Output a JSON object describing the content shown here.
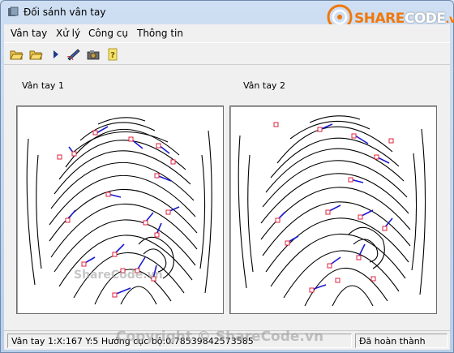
{
  "window": {
    "title": "Đối sánh vân tay"
  },
  "logo": {
    "part1": "SHARE",
    "part2": "CODE",
    "part3": ".vn"
  },
  "menu": [
    {
      "label": "Vân tay"
    },
    {
      "label": "Xử lý"
    },
    {
      "label": "Công cụ"
    },
    {
      "label": "Thông tin"
    }
  ],
  "toolbar": {
    "buttons": [
      "open-folder-icon",
      "open-folder-2-icon",
      "play-icon",
      "pen-icon",
      "camera-icon",
      "help-icon"
    ]
  },
  "panels": {
    "left_label": "Vân tay 1",
    "right_label": "Vân tay 2"
  },
  "status": {
    "left": "Vân tay 1:X:167 Y:5 Hướng cục bộ:0.78539842573585",
    "right": "Đã hoàn thành"
  },
  "watermarks": {
    "bottom": "Copyright © ShareCode.vn",
    "inner": "ShareCode.vn"
  },
  "colors": {
    "minutia_box": "#e0213c",
    "minutia_line": "#1a1ad0",
    "ridge": "#000000"
  }
}
